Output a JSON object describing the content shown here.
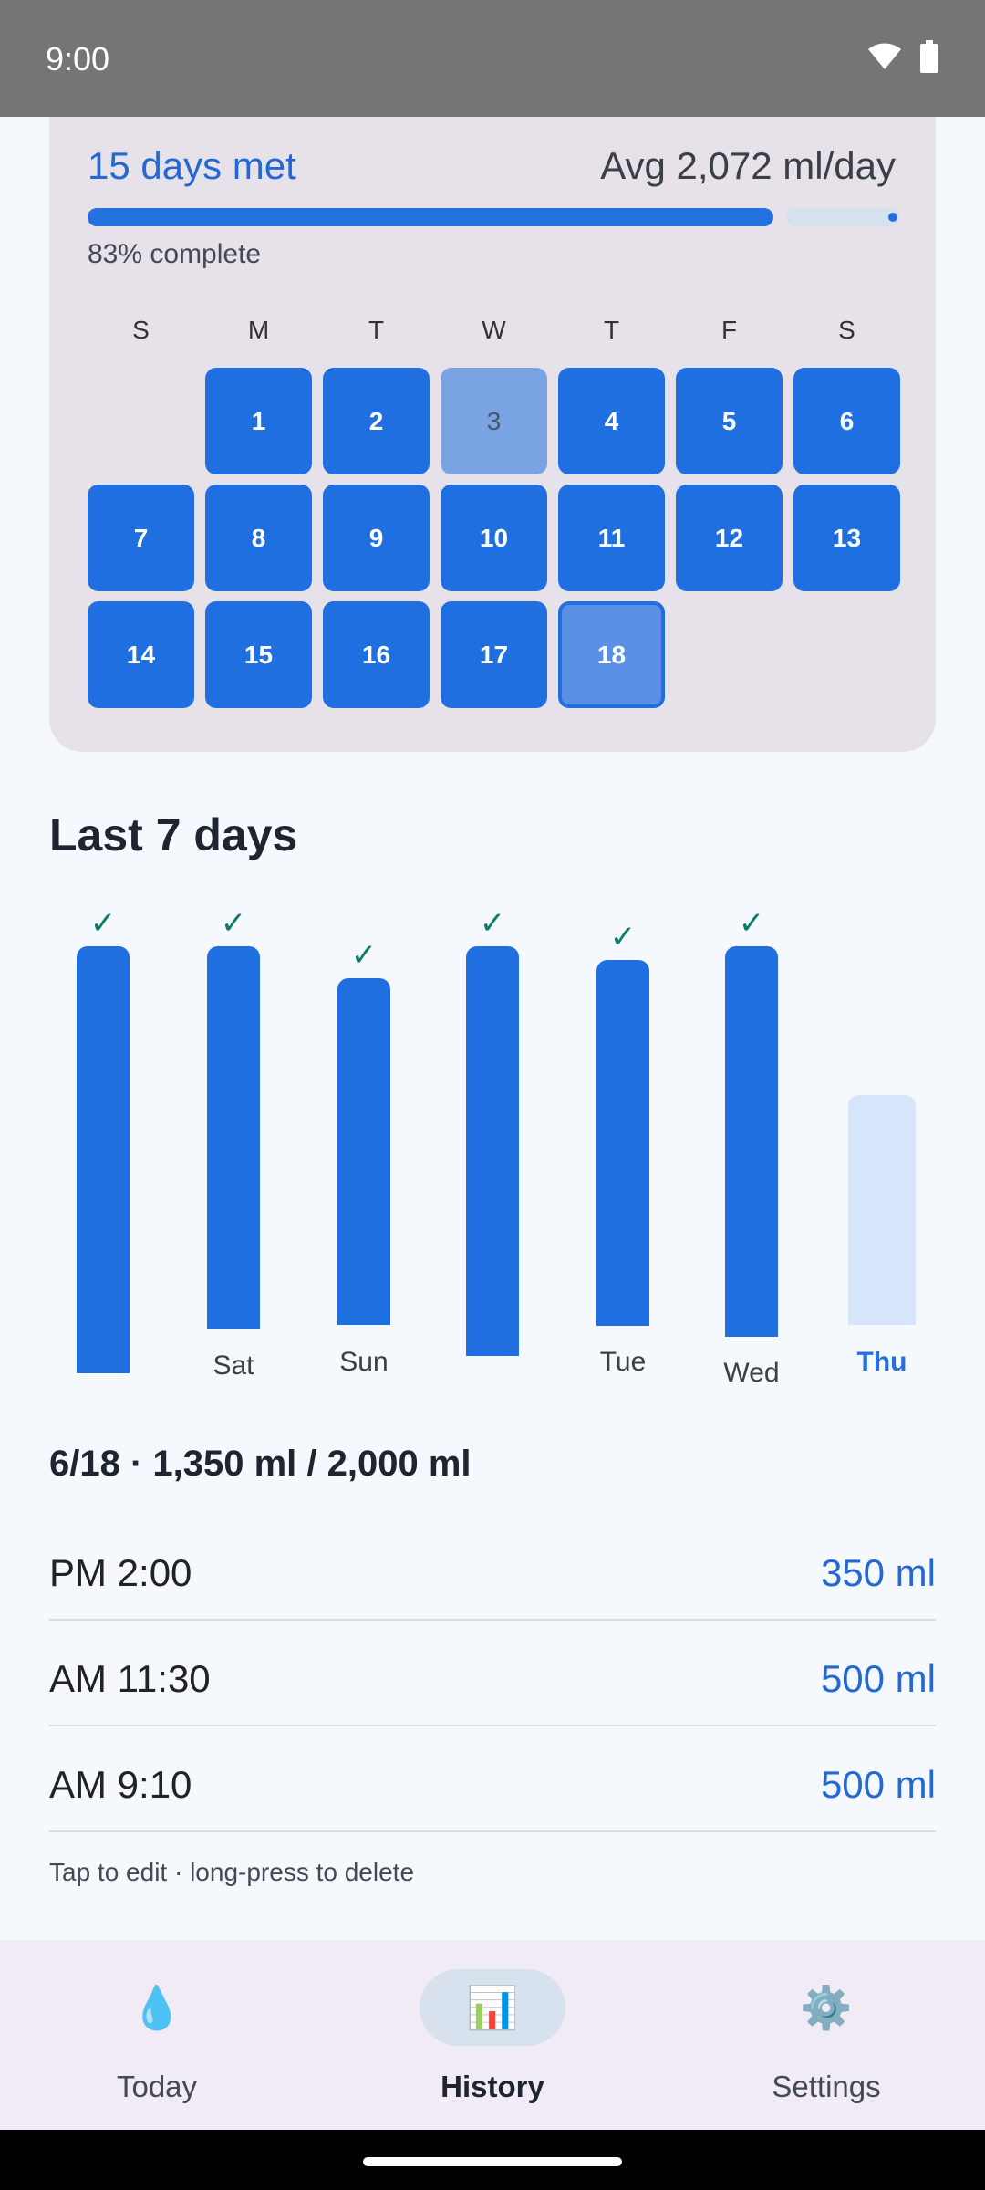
{
  "status": {
    "time": "9:00"
  },
  "summary": {
    "days_met": "15 days met",
    "avg": "Avg 2,072 ml/day",
    "progress": 0.83,
    "progress_text": "83% complete"
  },
  "calendar": {
    "weekdays": [
      "S",
      "M",
      "T",
      "W",
      "T",
      "F",
      "S"
    ],
    "days": [
      "1",
      "2",
      "3",
      "4",
      "5",
      "6",
      "7",
      "8",
      "9",
      "10",
      "11",
      "12",
      "13",
      "14",
      "15",
      "16",
      "17",
      "18"
    ]
  },
  "last7": {
    "title": "Last 7 days",
    "check": "✓",
    "labels": [
      "",
      "Sat",
      "Sun",
      "",
      "Tue",
      "Wed",
      "Thu"
    ]
  },
  "detail": {
    "summary": "6/18 · 1,350 ml / 2,000 ml",
    "entries": [
      {
        "time": "PM 2:00",
        "amount": "350 ml"
      },
      {
        "time": "AM 11:30",
        "amount": "500 ml"
      },
      {
        "time": "AM 9:10",
        "amount": "500 ml"
      }
    ],
    "hint": "Tap to edit · long-press to delete"
  },
  "nav": {
    "today": {
      "label": "Today",
      "icon": "💧"
    },
    "history": {
      "label": "History",
      "icon": "📊"
    },
    "settings": {
      "label": "Settings",
      "icon": "⚙️"
    }
  },
  "colors": {
    "accent": "#1f6fe0",
    "check": "#0f7b6c"
  }
}
